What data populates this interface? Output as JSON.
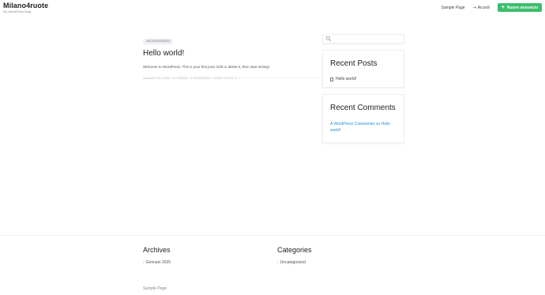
{
  "header": {
    "site_title": "Milano4ruote",
    "tagline": "My WordPress Blog",
    "nav": {
      "sample_page": "Sample Page",
      "login": "Accedi",
      "new_ad": "Nuovo annuncio"
    }
  },
  "post": {
    "category": "UNCATEGORIZED",
    "title": "Hello world!",
    "excerpt": "Welcome to WordPress. This is your first post. Edit or delete it, then start writing!",
    "meta": "JANUARY 11, 2025 · 0 THREAD · 1 COMMENTO · LEGGI TUTTO"
  },
  "sidebar": {
    "recent_posts": {
      "title": "Recent Posts",
      "items": [
        "Hello world!"
      ]
    },
    "recent_comments": {
      "title": "Recent Comments",
      "text": "A WordPress Commenter su Hello world!"
    }
  },
  "footer": {
    "archives": {
      "title": "Archives",
      "items": [
        "Gennaio 2025"
      ]
    },
    "categories": {
      "title": "Categories",
      "items": [
        "Uncategorized"
      ]
    },
    "sample_page": "Sample Page"
  },
  "colors": {
    "accent": "#3dbd6c",
    "link": "#2a8fd8"
  },
  "icons": [
    "login-icon",
    "plus-icon",
    "search-icon",
    "document-icon",
    "chevron-right-icon"
  ]
}
